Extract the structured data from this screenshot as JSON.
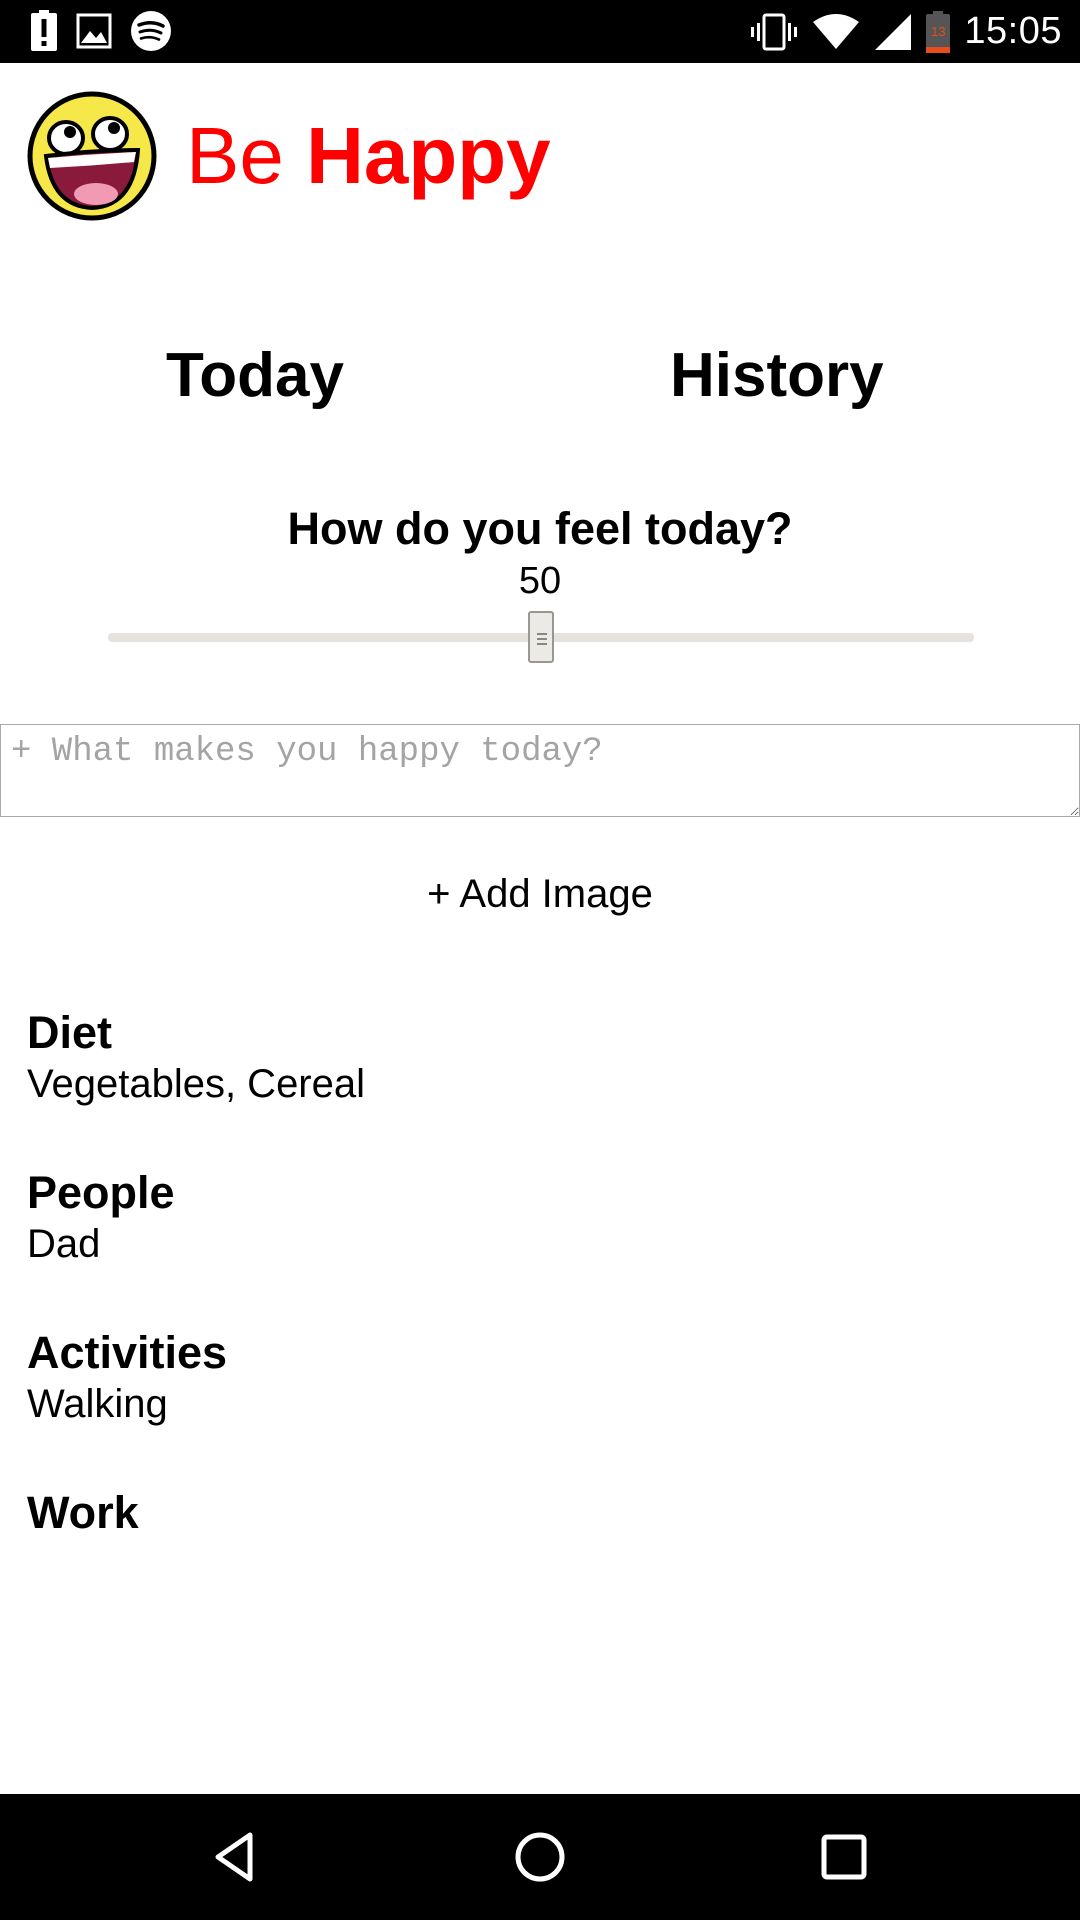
{
  "status_bar": {
    "time": "15:05",
    "battery_level": "13",
    "left_icons": [
      "alert-icon",
      "image-icon",
      "spotify-icon"
    ],
    "right_icons": [
      "vibrate-icon",
      "wifi-icon",
      "signal-icon",
      "battery-icon"
    ]
  },
  "header": {
    "title_part1": "Be",
    "title_part2": "Happy",
    "title_color": "#ff0000"
  },
  "tabs": [
    {
      "label": "Today"
    },
    {
      "label": "History"
    }
  ],
  "mood": {
    "question": "How do you feel today?",
    "value": "50",
    "slider_min": 0,
    "slider_max": 100
  },
  "happy_input": {
    "value": "",
    "placeholder": "+ What makes you happy today?"
  },
  "add_image_label": "+ Add Image",
  "categories": [
    {
      "title": "Diet",
      "value": "Vegetables, Cereal"
    },
    {
      "title": "People",
      "value": "Dad"
    },
    {
      "title": "Activities",
      "value": "Walking"
    },
    {
      "title": "Work",
      "value": ""
    }
  ],
  "nav_bar": {
    "buttons": [
      "back-icon",
      "home-icon",
      "recents-icon"
    ]
  }
}
